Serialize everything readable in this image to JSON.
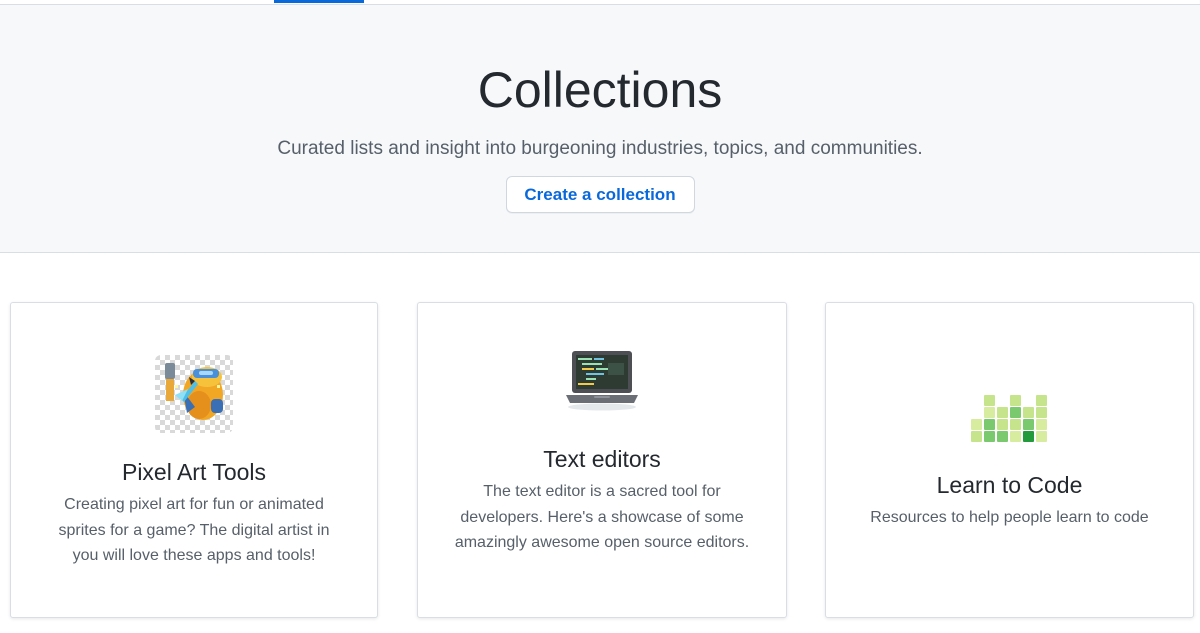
{
  "header": {
    "active_tab_color": "#0969da"
  },
  "hero": {
    "title": "Collections",
    "subtitle": "Curated lists and insight into burgeoning industries, topics, and communities.",
    "create_button_label": "Create a collection"
  },
  "collections": [
    {
      "title": "Pixel Art Tools",
      "description": "Creating pixel art for fun or animated sprites for a game? The digital artist in you will love these apps and tools!",
      "icon": "pixel-art-robot-icon"
    },
    {
      "title": "Text editors",
      "description": "The text editor is a sacred tool for developers. Here's a showcase of some amazingly awesome open source editors.",
      "icon": "laptop-icon"
    },
    {
      "title": "Learn to Code",
      "description": "Resources to help people learn to code",
      "icon": "contribution-graph-icon"
    }
  ],
  "colors": {
    "accent": "#0969da",
    "hero_background": "#f6f8fa",
    "text_primary": "#24292f",
    "text_secondary": "#57606a"
  }
}
